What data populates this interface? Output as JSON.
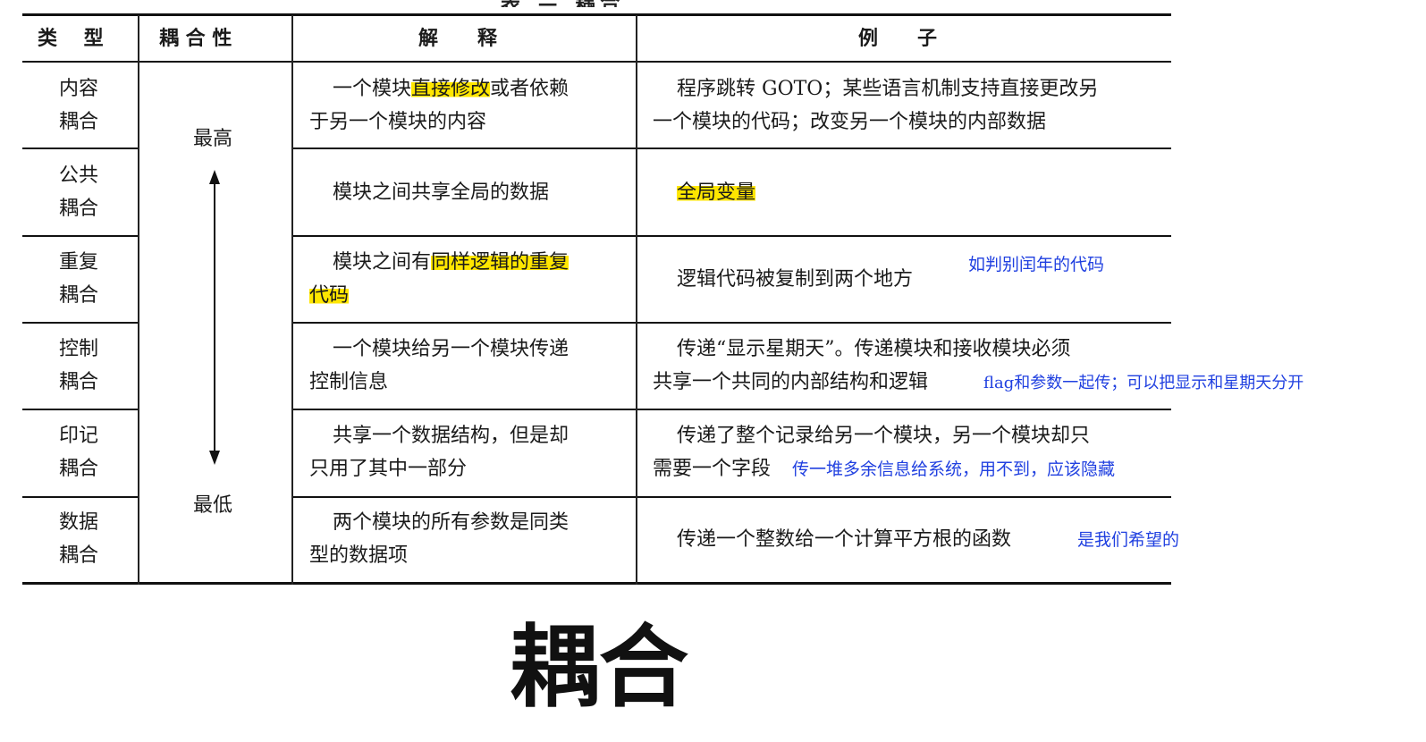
{
  "table": {
    "caption": "表 — 耦合",
    "headers": {
      "type": "类　 型",
      "coupling": "耦 合 性",
      "explanation": "解　　释",
      "example": "例　　子"
    },
    "level_high": "最高",
    "level_low": "最低",
    "rows": [
      {
        "type_line1": "内容",
        "type_line2": "耦合",
        "expl_a": "一个模块",
        "expl_hl": "直接修改",
        "expl_b": "或者依赖",
        "expl_line2": "于另一个模块的内容",
        "ex_line1": "程序跳转 GOTO；某些语言机制支持直接更改另",
        "ex_line2": "一个模块的代码；改变另一个模块的内部数据"
      },
      {
        "type_line1": "公共",
        "type_line2": "耦合",
        "expl_line1": "模块之间共享全局的数据",
        "ex_hl": "全局变量"
      },
      {
        "type_line1": "重复",
        "type_line2": "耦合",
        "expl_a": "模块之间有",
        "expl_hl": "同样逻辑的重复",
        "expl_hl2": "代码",
        "ex_line1": "逻辑代码被复制到两个地方"
      },
      {
        "type_line1": "控制",
        "type_line2": "耦合",
        "expl_line1": "一个模块给另一个模块传递",
        "expl_line2": "控制信息",
        "ex_line1": "传递“显示星期天”。传递模块和接收模块必须",
        "ex_line2": "共享一个共同的内部结构和逻辑"
      },
      {
        "type_line1": "印记",
        "type_line2": "耦合",
        "expl_line1": "共享一个数据结构，但是却",
        "expl_line2": "只用了其中一部分",
        "ex_line1": "传递了整个记录给另一个模块，另一个模块却只",
        "ex_line2": "需要一个字段"
      },
      {
        "type_line1": "数据",
        "type_line2": "耦合",
        "expl_line1": "两个模块的所有参数是同类",
        "expl_line2": "型的数据项",
        "ex_line1": "传递一个整数给一个计算平方根的函数"
      }
    ]
  },
  "annotations": {
    "repeat": "如判别闰年的代码",
    "control": "flag和参数一起传；可以把显示和星期天分开",
    "stamp": "传一堆多余信息给系统，用不到，应该隐藏",
    "data": "是我们希望的"
  },
  "slide_title": "耦合",
  "colors": {
    "highlight": "#ffe600",
    "annotation": "#2040e0",
    "rule": "#111111"
  }
}
